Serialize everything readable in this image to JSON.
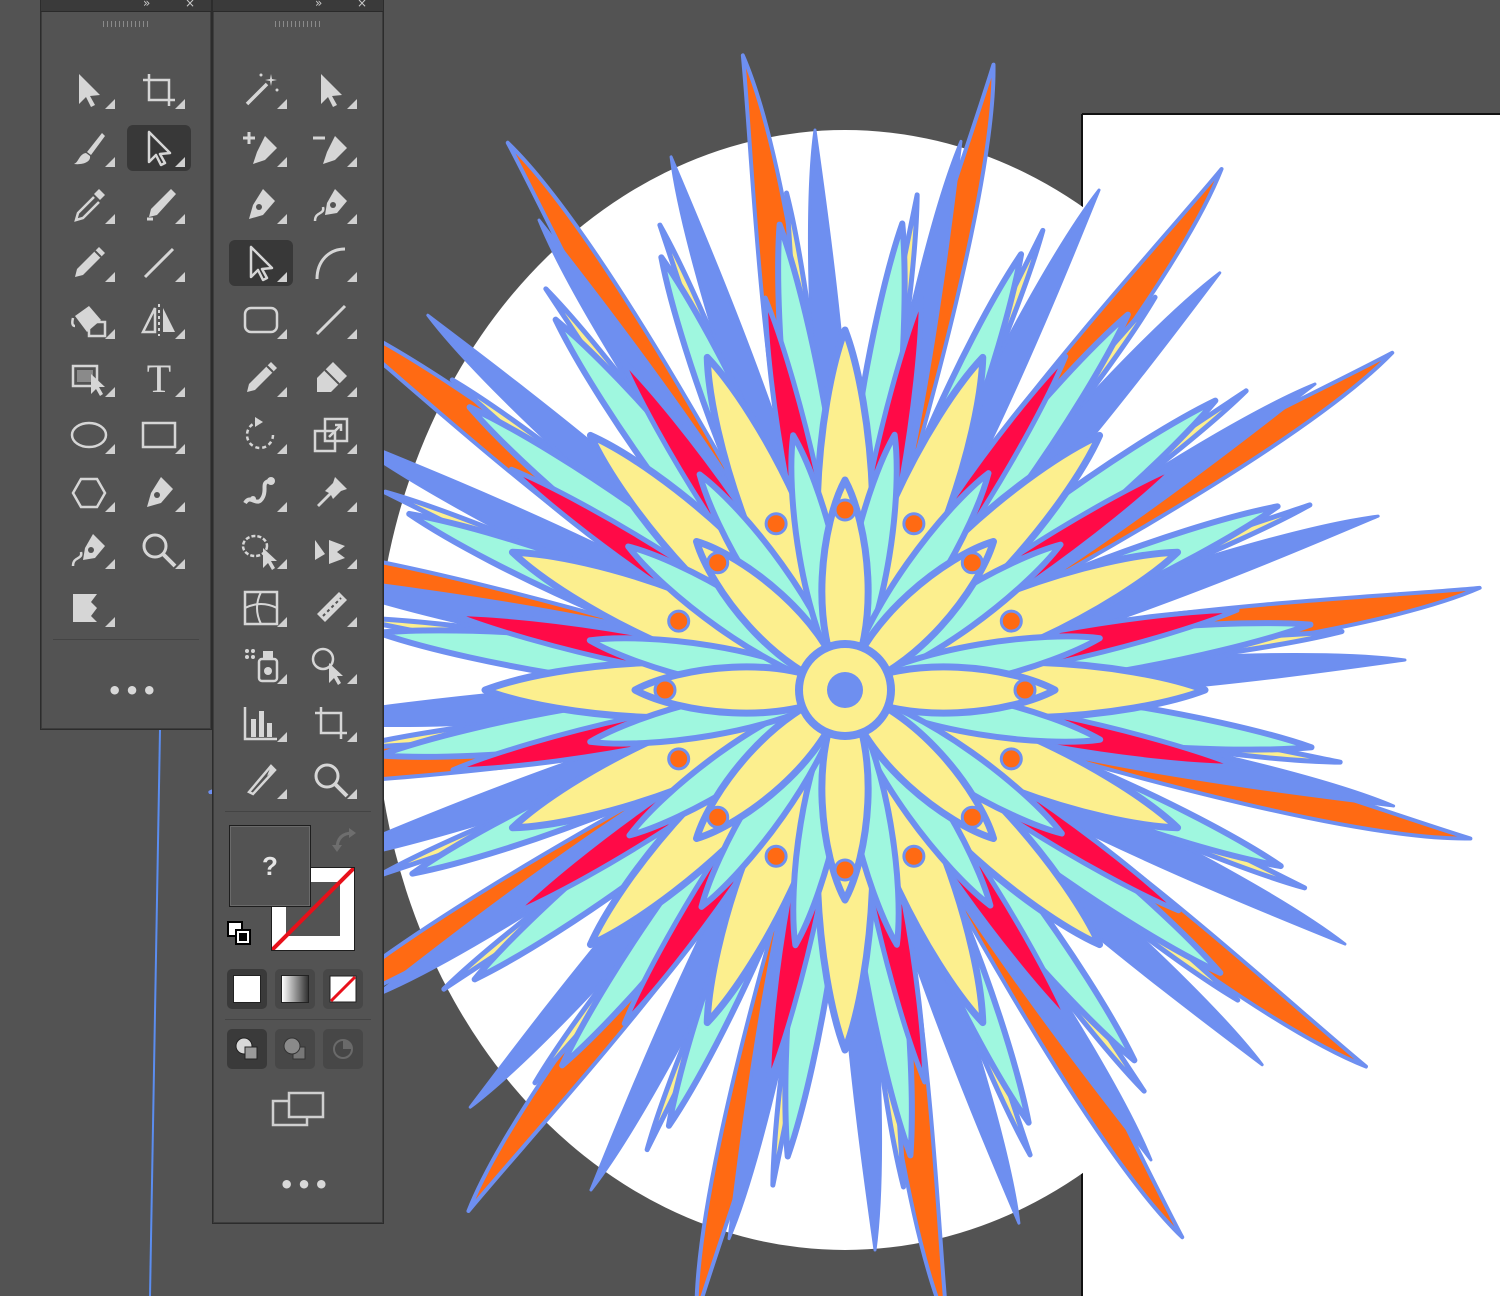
{
  "app": {
    "accent_guide_color": "#5b8def",
    "canvas_bg": "#535353",
    "artboard_bg": "#ffffff"
  },
  "artwork": {
    "name": "mandala-illustration",
    "colors": {
      "orange": "#ff6a13",
      "periwinkle": "#6e8ff0",
      "mint": "#9ff7df",
      "yellow": "#fcef8e",
      "red": "#ff0a47"
    }
  },
  "toolbar_left": {
    "tools": [
      {
        "name": "selection-tool",
        "icon": "arrow-solid-icon"
      },
      {
        "name": "artboard-tool",
        "icon": "artboard-icon"
      },
      {
        "name": "paintbrush-tool",
        "icon": "brush-icon"
      },
      {
        "name": "direct-selection-tool",
        "icon": "arrow-outline-icon",
        "active": true
      },
      {
        "name": "eyedropper-tool",
        "icon": "eyedropper-icon"
      },
      {
        "name": "blob-brush-tool",
        "icon": "blob-brush-icon"
      },
      {
        "name": "pencil-tool",
        "icon": "pencil-icon"
      },
      {
        "name": "line-segment-tool",
        "icon": "line-icon"
      },
      {
        "name": "live-paint-bucket-tool",
        "icon": "paint-bucket-icon"
      },
      {
        "name": "reflect-tool",
        "icon": "reflect-icon"
      },
      {
        "name": "live-paint-selection-tool",
        "icon": "live-paint-select-icon"
      },
      {
        "name": "type-tool",
        "icon": "type-icon",
        "glyph": "T"
      },
      {
        "name": "ellipse-tool",
        "icon": "ellipse-icon"
      },
      {
        "name": "rectangle-tool",
        "icon": "rectangle-icon"
      },
      {
        "name": "polygon-tool",
        "icon": "polygon-icon"
      },
      {
        "name": "pen-tool",
        "icon": "pen-icon"
      },
      {
        "name": "curvature-tool",
        "icon": "curvature-pen-icon"
      },
      {
        "name": "zoom-tool",
        "icon": "magnifier-icon"
      },
      {
        "name": "width-tool",
        "icon": "width-icon"
      }
    ],
    "more_label": "•••"
  },
  "toolbar_right": {
    "tools": [
      {
        "name": "magic-wand-tool",
        "icon": "magic-wand-icon"
      },
      {
        "name": "selection-tool",
        "icon": "arrow-solid-icon"
      },
      {
        "name": "add-anchor-point-tool",
        "icon": "add-anchor-icon"
      },
      {
        "name": "delete-anchor-point-tool",
        "icon": "delete-anchor-icon"
      },
      {
        "name": "pen-tool",
        "icon": "pen-icon"
      },
      {
        "name": "curvature-tool",
        "icon": "curvature-pen-icon"
      },
      {
        "name": "direct-selection-tool",
        "icon": "arrow-outline-icon",
        "active": true
      },
      {
        "name": "arc-tool",
        "icon": "arc-icon"
      },
      {
        "name": "rounded-rectangle-tool",
        "icon": "rounded-rect-icon"
      },
      {
        "name": "line-segment-tool",
        "icon": "line-icon"
      },
      {
        "name": "pencil-tool",
        "icon": "pencil-icon"
      },
      {
        "name": "eraser-tool",
        "icon": "eraser-icon"
      },
      {
        "name": "rotate-tool",
        "icon": "rotate-icon"
      },
      {
        "name": "scale-tool",
        "icon": "scale-icon"
      },
      {
        "name": "puppet-warp-tool",
        "icon": "puppet-warp-icon"
      },
      {
        "name": "pin-tool",
        "icon": "pin-icon"
      },
      {
        "name": "free-transform-tool",
        "icon": "free-transform-icon"
      },
      {
        "name": "perspective-selection-tool",
        "icon": "perspective-icon"
      },
      {
        "name": "mesh-tool",
        "icon": "mesh-icon"
      },
      {
        "name": "gradient-tool",
        "icon": "gradient-icon"
      },
      {
        "name": "symbol-sprayer-tool",
        "icon": "symbol-sprayer-icon"
      },
      {
        "name": "blend-tool",
        "icon": "blend-icon"
      },
      {
        "name": "column-graph-tool",
        "icon": "column-graph-icon"
      },
      {
        "name": "artboard-tool",
        "icon": "artboard-icon"
      },
      {
        "name": "slice-tool",
        "icon": "slice-icon"
      },
      {
        "name": "zoom-tool",
        "icon": "magnifier-icon"
      }
    ],
    "fill_swatch_label": "?",
    "more_label": "•••"
  }
}
